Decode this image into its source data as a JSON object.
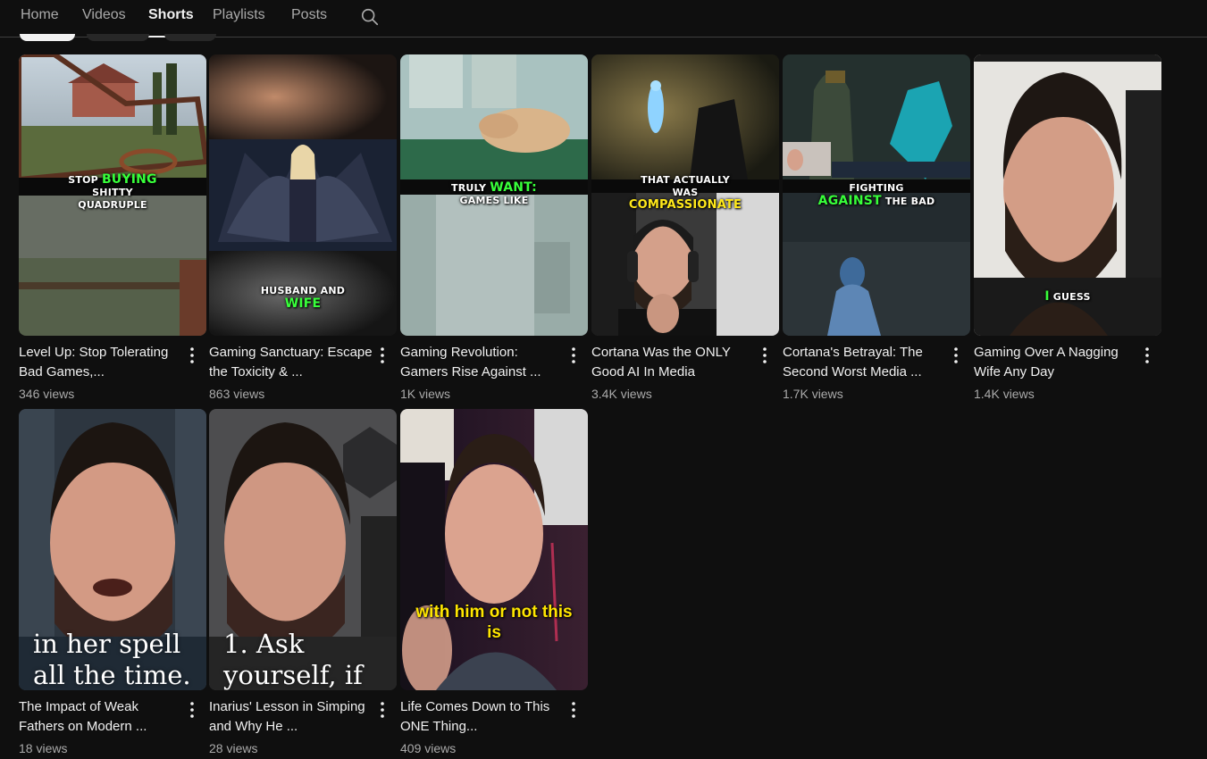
{
  "tabs": [
    "Home",
    "Videos",
    "Shorts",
    "Playlists",
    "Posts"
  ],
  "active_tab": "Shorts",
  "icons": {
    "search": "search-icon",
    "more": "more-vert-icon"
  },
  "shorts": [
    {
      "title": "Level Up: Stop Tolerating Bad Games,...",
      "views": "346 views",
      "caption": {
        "pre": "STOP ",
        "hl": "BUYING",
        "post": "SHITTY",
        "line3": "QUADRUPLE"
      }
    },
    {
      "title": "Gaming Sanctuary: Escape the Toxicity & ...",
      "views": "863 views",
      "caption": {
        "line1": "HUSBAND AND",
        "hl": "WIFE"
      }
    },
    {
      "title": "Gaming Revolution: Gamers Rise Against ...",
      "views": "1K views",
      "caption": {
        "pre": "TRULY ",
        "hl": "WANT:",
        "line2": "GAMES LIKE"
      }
    },
    {
      "title": "Cortana Was the ONLY Good AI In Media",
      "views": "3.4K views",
      "caption": {
        "line1": "THAT ACTUALLY",
        "line2": "WAS",
        "hl": "COMPASSIONATE"
      }
    },
    {
      "title": "Cortana's Betrayal: The Second Worst Media ...",
      "views": "1.7K views",
      "caption": {
        "line1": "FIGHTING",
        "hl": "AGAINST",
        "post": " THE BAD"
      }
    },
    {
      "title": "Gaming Over A Nagging Wife Any Day",
      "views": "1.4K views",
      "caption": {
        "hl": "I",
        "post": " GUESS"
      }
    },
    {
      "title": "The Impact of Weak Fathers on Modern ...",
      "views": "18 views",
      "caption": {
        "line1": "in her spell",
        "line2": "all the time."
      }
    },
    {
      "title": "Inarius' Lesson in Simping and Why He ...",
      "views": "28 views",
      "caption": {
        "line1": "1. Ask",
        "line2": "yourself, if"
      }
    },
    {
      "title": "Life Comes Down to This ONE Thing...",
      "views": "409 views",
      "caption": {
        "line1": "with him or not this",
        "line2": "is"
      }
    }
  ]
}
